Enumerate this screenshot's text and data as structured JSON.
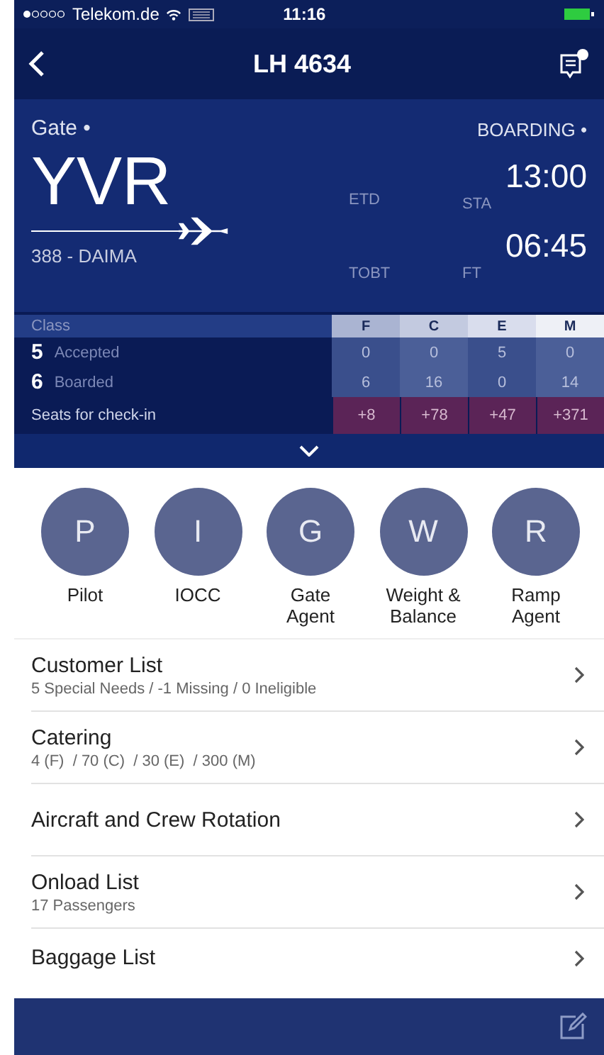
{
  "status_bar": {
    "carrier": "Telekom.de",
    "time": "11:16"
  },
  "nav": {
    "title": "LH 4634"
  },
  "flight": {
    "gate_label": "Gate •",
    "airport": "YVR",
    "aircraft": "388 - DAIMA",
    "status": "BOARDING •",
    "etd_label": "ETD",
    "tobt_label": "TOBT",
    "sta_time": "13:00",
    "sta_label": "STA",
    "ft_time": "06:45",
    "ft_label": "FT"
  },
  "class_table": {
    "header": "Class",
    "columns": [
      "F",
      "C",
      "E",
      "M"
    ],
    "rows": [
      {
        "count": "5",
        "label": "Accepted",
        "values": [
          "0",
          "0",
          "5",
          "0"
        ]
      },
      {
        "count": "6",
        "label": "Boarded",
        "values": [
          "6",
          "16",
          "0",
          "14"
        ]
      }
    ],
    "seats": {
      "label": "Seats for check-in",
      "values": [
        "+8",
        "+78",
        "+47",
        "+371"
      ]
    }
  },
  "contacts": [
    {
      "initial": "P",
      "label": "Pilot"
    },
    {
      "initial": "I",
      "label": "IOCC"
    },
    {
      "initial": "G",
      "label": "Gate Agent"
    },
    {
      "initial": "W",
      "label": "Weight & Balance"
    },
    {
      "initial": "R",
      "label": "Ramp Agent"
    }
  ],
  "menu": [
    {
      "title": "Customer List",
      "subtitle": "5 Special Needs / -1 Missing / 0 Ineligible"
    },
    {
      "title": "Catering",
      "subtitle": "4 (F)  / 70 (C)  / 30 (E)  / 300 (M)"
    },
    {
      "title": "Aircraft and Crew Rotation"
    },
    {
      "title": "Onload List",
      "subtitle": "17 Passengers"
    },
    {
      "title": "Baggage List"
    }
  ]
}
